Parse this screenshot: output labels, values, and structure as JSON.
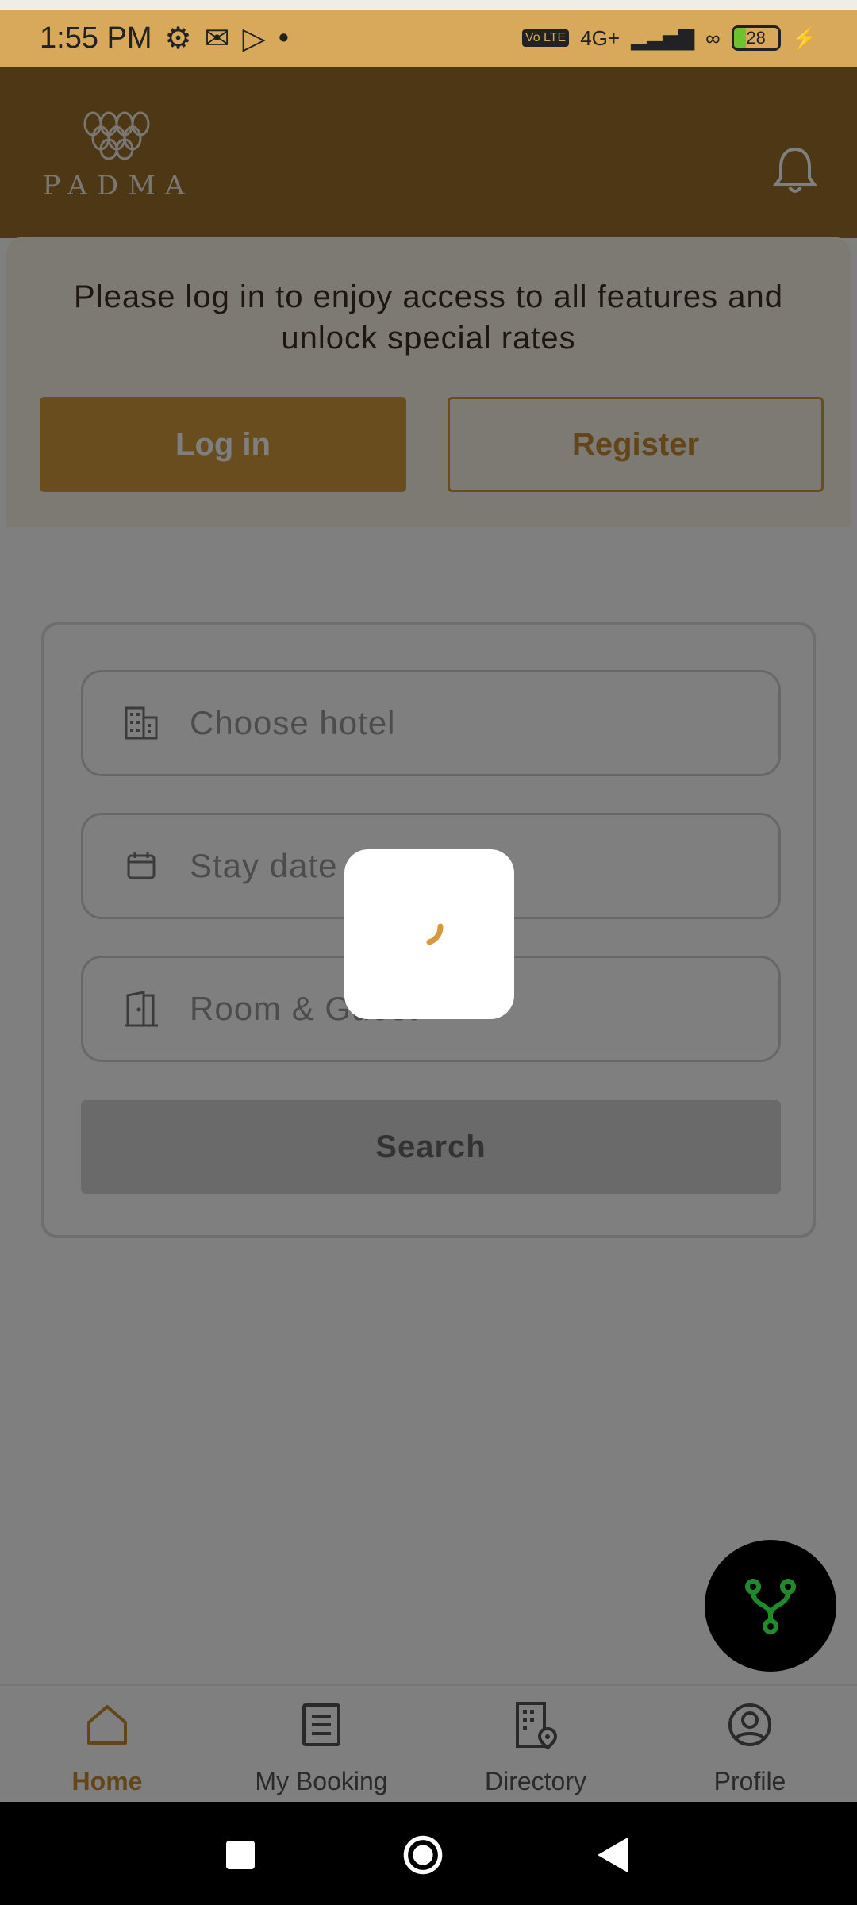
{
  "status_bar": {
    "time": "1:55 PM",
    "network": "4G+",
    "battery": "28",
    "battery_level": 0.28
  },
  "header": {
    "logo_text": "PADMA"
  },
  "login_prompt": {
    "message": "Please log in to enjoy access to all features and unlock special rates",
    "login_label": "Log in",
    "register_label": "Register"
  },
  "search_form": {
    "hotel_placeholder": "Choose hotel",
    "date_placeholder": "Stay date",
    "room_placeholder": "Room & Guest",
    "search_label": "Search"
  },
  "bottom_nav": {
    "items": [
      {
        "label": "Home",
        "icon": "home-icon",
        "active": true
      },
      {
        "label": "My Booking",
        "icon": "document-icon",
        "active": false
      },
      {
        "label": "Directory",
        "icon": "building-pin-icon",
        "active": false
      },
      {
        "label": "Profile",
        "icon": "user-circle-icon",
        "active": false
      }
    ]
  },
  "colors": {
    "brand": "#d59a3e",
    "header": "#9a6f2b",
    "status_bar": "#d9a95b"
  }
}
